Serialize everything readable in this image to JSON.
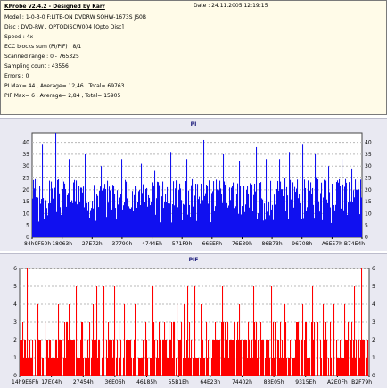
{
  "report": {
    "title": "KProbe v2.4.2 - Designed by Karr",
    "date": "Date : 24.11.2005 12:19:15",
    "lines": [
      "Model : 1-0-3-0 F:LITE-ON DVDRW SOHW-1673S JS0B",
      "Disc : DVD-RW , OPTODISCW004 [Opto Disc]",
      "Speed : 4x",
      "ECC blocks sum (PI/PIF) : 8/1",
      "Scanned range : 0 - 765325",
      "Sampling count : 43556",
      "Errors : 0",
      "PI Max= 44 , Average= 12,46 , Total= 69763",
      "PIF Max= 6 , Average= 2,84 , Total= 15905"
    ]
  },
  "colors": {
    "pi": "#1010f0",
    "pif": "#ff0000",
    "panel": "#e9e9f2",
    "plot": "#ffffff",
    "info_bg": "#fffbe8"
  },
  "chart_data": [
    {
      "type": "bar",
      "title": "PI",
      "color": "#1010f0",
      "ylim": [
        0,
        44
      ],
      "yticks": [
        0,
        5,
        10,
        15,
        20,
        25,
        30,
        35,
        40
      ],
      "xtick_labels": [
        "84h9F50h",
        "18063h",
        "27E72h",
        "37790h",
        "4744Eh",
        "571F9h",
        "66EEFh",
        "76E39h",
        "86B73h",
        "96708h",
        "A6E57h",
        "B74E4h"
      ],
      "baseline": 12,
      "typical_peak": 25,
      "spikes": [
        [
          0.03,
          39
        ],
        [
          0.07,
          44
        ],
        [
          0.11,
          33
        ],
        [
          0.16,
          35
        ],
        [
          0.21,
          30
        ],
        [
          0.27,
          33
        ],
        [
          0.33,
          31
        ],
        [
          0.37,
          28
        ],
        [
          0.42,
          36
        ],
        [
          0.47,
          33
        ],
        [
          0.52,
          41
        ],
        [
          0.58,
          35
        ],
        [
          0.63,
          32
        ],
        [
          0.68,
          38
        ],
        [
          0.71,
          33
        ],
        [
          0.75,
          33
        ],
        [
          0.78,
          36
        ],
        [
          0.82,
          39
        ],
        [
          0.86,
          35
        ],
        [
          0.9,
          30
        ],
        [
          0.94,
          33
        ],
        [
          0.97,
          29
        ]
      ]
    },
    {
      "type": "bar",
      "title": "PIF",
      "color": "#ff0000",
      "ylim": [
        0,
        6
      ],
      "yticks": [
        0,
        1,
        2,
        3,
        4,
        5,
        6
      ],
      "xtick_labels": [
        "14h9E6Fh",
        "17E04h",
        "27454h",
        "36E06h",
        "46185h",
        "55B1Eh",
        "64E23h",
        "74402h",
        "83E05h",
        "9315Eh",
        "A2E0Fh",
        "B2F79h"
      ],
      "baseline": 2,
      "spikes": [
        [
          0.02,
          6
        ],
        [
          0.05,
          4
        ],
        [
          0.11,
          4
        ],
        [
          0.14,
          4
        ],
        [
          0.16,
          5
        ],
        [
          0.18,
          3
        ],
        [
          0.21,
          4
        ],
        [
          0.22,
          5
        ],
        [
          0.24,
          5
        ],
        [
          0.27,
          5
        ],
        [
          0.3,
          4
        ],
        [
          0.33,
          4
        ],
        [
          0.38,
          5
        ],
        [
          0.4,
          3
        ],
        [
          0.45,
          4
        ],
        [
          0.47,
          4
        ],
        [
          0.48,
          5
        ],
        [
          0.5,
          5
        ],
        [
          0.52,
          4
        ],
        [
          0.58,
          5
        ],
        [
          0.63,
          4
        ],
        [
          0.67,
          5
        ],
        [
          0.72,
          5
        ],
        [
          0.76,
          4
        ],
        [
          0.81,
          4
        ],
        [
          0.84,
          5
        ],
        [
          0.87,
          4
        ],
        [
          0.9,
          4
        ],
        [
          0.93,
          4
        ],
        [
          0.96,
          5
        ],
        [
          0.98,
          6
        ]
      ]
    }
  ]
}
